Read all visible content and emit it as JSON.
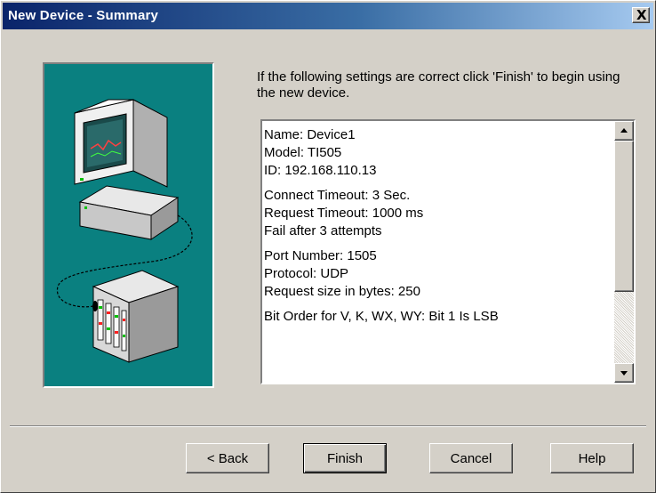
{
  "window": {
    "title": "New Device - Summary",
    "close_label": "X"
  },
  "instructions": "If the following settings are correct click 'Finish' to begin using the new device.",
  "summary": {
    "groups": [
      [
        "Name: Device1",
        "Model: TI505",
        "ID: 192.168.110.13"
      ],
      [
        "Connect Timeout: 3 Sec.",
        "Request Timeout: 1000 ms",
        "Fail after 3 attempts"
      ],
      [
        "Port Number: 1505",
        "Protocol: UDP",
        "Request size in bytes: 250"
      ],
      [
        "Bit Order for V, K, WX, WY: Bit 1 Is LSB"
      ]
    ]
  },
  "buttons": {
    "back": "< Back",
    "finish": "Finish",
    "cancel": "Cancel",
    "help": "Help"
  },
  "icons": {
    "illustration": "computer-connected-to-device-rack",
    "close": "close-icon",
    "scroll_up": "chevron-up-icon",
    "scroll_down": "chevron-down-icon"
  },
  "colors": {
    "titlebar_start": "#0a246a",
    "titlebar_end": "#a6caf0",
    "dialog_face": "#d4d0c8",
    "illustration_bg": "#0a8080"
  }
}
